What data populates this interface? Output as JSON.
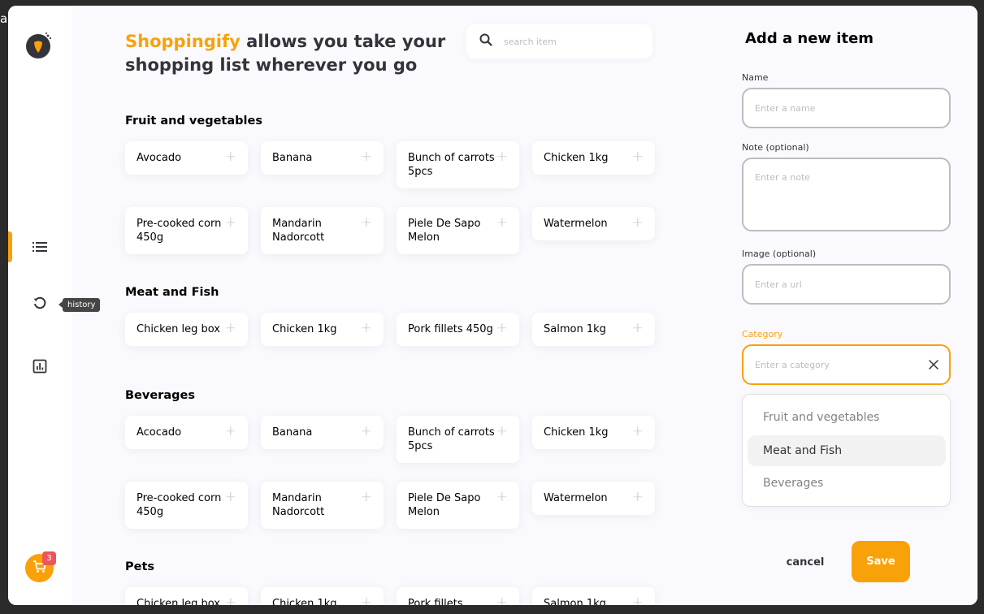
{
  "corner_text": "a",
  "colors": {
    "accent": "#f9a109",
    "badge": "#eb5757",
    "text": "#34333a"
  },
  "sidebar": {
    "logo_icon": "carrot-logo",
    "nav": [
      {
        "icon": "list-icon",
        "active": true
      },
      {
        "icon": "history-icon",
        "active": false,
        "tooltip": "history"
      },
      {
        "icon": "stats-icon",
        "active": false
      }
    ],
    "cart_badge": "3"
  },
  "header": {
    "brand": "Shoppingify",
    "tagline": " allows you take your shopping list wherever you go"
  },
  "search": {
    "placeholder": "search item"
  },
  "sections": [
    {
      "title": "Fruit and vegetables",
      "items": [
        "Avocado",
        "Banana",
        "Bunch of carrots 5pcs",
        "Chicken 1kg",
        "Pre-cooked corn 450g",
        "Mandarin Nadorcott",
        "Piele De Sapo Melon",
        "Watermelon"
      ]
    },
    {
      "title": "Meat and Fish",
      "items": [
        "Chicken leg box",
        "Chicken 1kg",
        "Pork fillets 450g",
        "Salmon 1kg"
      ]
    },
    {
      "title": "Beverages",
      "items": [
        "Acocado",
        "Banana",
        "Bunch of carrots 5pcs",
        "Chicken 1kg",
        "Pre-cooked corn 450g",
        "Mandarin Nadorcott",
        "Piele De Sapo Melon",
        "Watermelon"
      ]
    },
    {
      "title": "Pets",
      "items": [
        "Chicken leg box",
        "Chicken 1kg",
        "Pork fillets",
        "Salmon 1kg"
      ]
    }
  ],
  "form": {
    "title": "Add a new item",
    "name_label": "Name",
    "name_placeholder": "Enter a name",
    "note_label": "Note (optional)",
    "note_placeholder": "Enter a note",
    "image_label": "Image (optional)",
    "image_placeholder": "Enter a url",
    "category_label": "Category",
    "category_placeholder": "Enter a category",
    "category_options": [
      "Fruit and vegetables",
      "Meat and Fish",
      "Beverages"
    ],
    "selected_option": "Meat and Fish",
    "cancel_label": "cancel",
    "save_label": "Save"
  }
}
